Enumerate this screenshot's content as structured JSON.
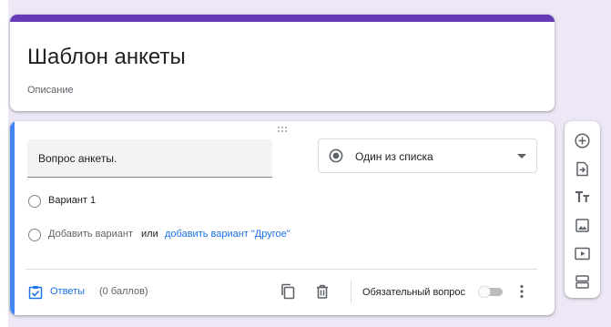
{
  "form": {
    "title": "Шаблон анкеты",
    "description": "Описание"
  },
  "question": {
    "text": "Вопрос анкеты.",
    "type_label": "Один из списка",
    "options": [
      {
        "label": "Вариант 1"
      }
    ],
    "add_option_label": "Добавить вариант",
    "or_label": "или",
    "add_other_label": "добавить вариант \"Другое\"",
    "answers_label": "Ответы",
    "points_label": "(0 баллов)",
    "required_label": "Обязательный вопрос",
    "required": false
  },
  "toolbar": {
    "icons": [
      "add-question-icon",
      "import-questions-icon",
      "add-title-icon",
      "add-image-icon",
      "add-video-icon",
      "add-section-icon"
    ]
  },
  "colors": {
    "accent": "#673ab7",
    "active_question": "#4285f4",
    "link": "#1a73e8",
    "background": "#ede7f6"
  }
}
